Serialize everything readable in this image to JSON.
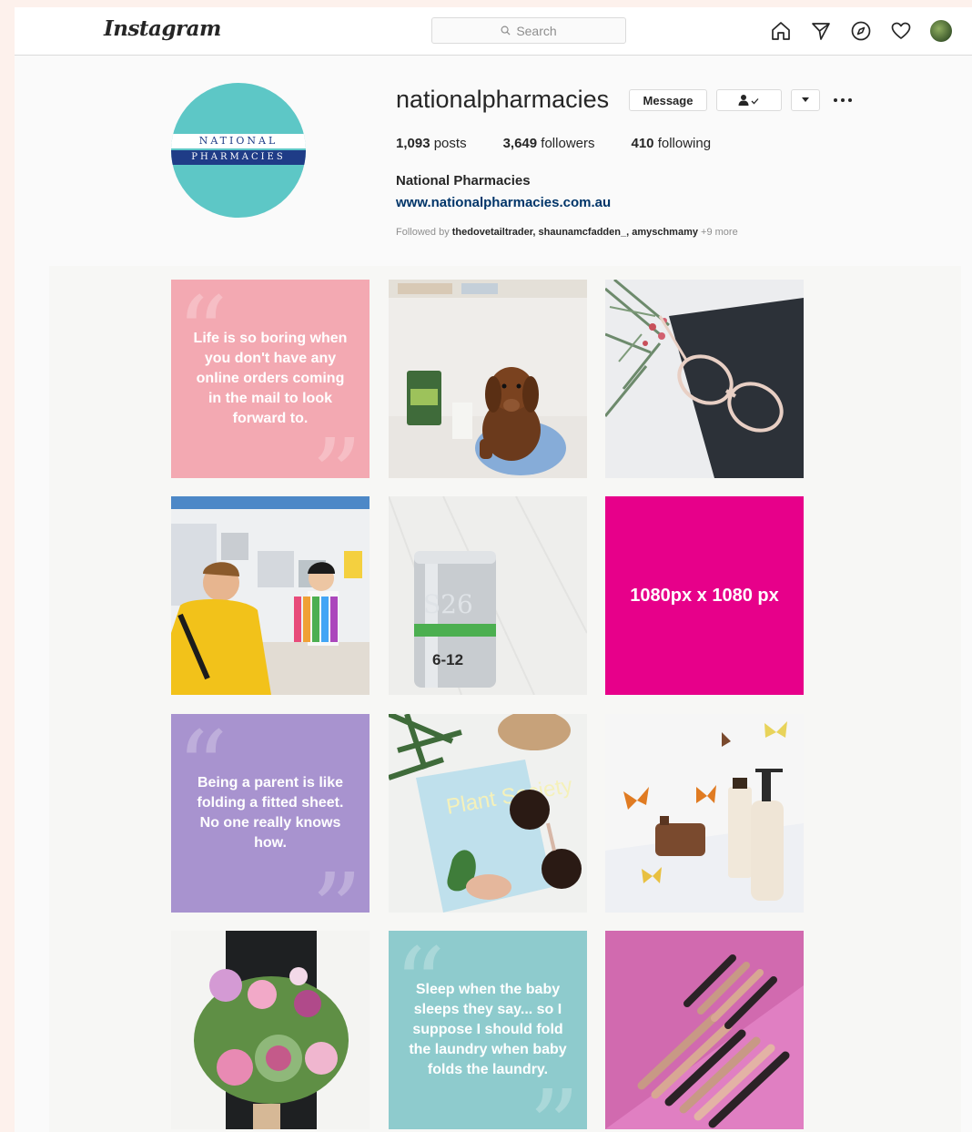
{
  "nav": {
    "logo": "Instagram",
    "search_placeholder": "Search"
  },
  "profile": {
    "logo_line1": "NATIONAL",
    "logo_line2": "PHARMACIES",
    "username": "nationalpharmacies",
    "message_label": "Message",
    "posts_count": "1,093",
    "posts_label": "posts",
    "followers_count": "3,649",
    "followers_label": "followers",
    "following_count": "410",
    "following_label": "following",
    "full_name": "National Pharmacies",
    "website": "www.nationalpharmacies.com.au",
    "followed_by_prefix": "Followed by",
    "followed_by_names": "thedovetailtrader, shaunamcfadden_, amyschmamy",
    "followed_by_more": "+9 more"
  },
  "posts": {
    "quote1": "Life is so boring when you don't have any online orders coming in the mail to look forward to.",
    "dimension_label": "1080px x 1080 px",
    "quote2": "Being a parent is like folding a fitted sheet. No one really knows how.",
    "can_label": "S26",
    "can_sub": "6-12",
    "book_title": "Plant Society",
    "quote3": "Sleep when the baby sleeps they say... so I suppose I should fold the laundry when baby folds the laundry."
  },
  "colors": {
    "quote_pink": "#f3a9b2",
    "magenta": "#e7008a",
    "lavender": "#a893cf",
    "teal": "#8ecbcd",
    "brand_navy": "#1f3c87",
    "profile_teal": "#5dc7c6"
  }
}
